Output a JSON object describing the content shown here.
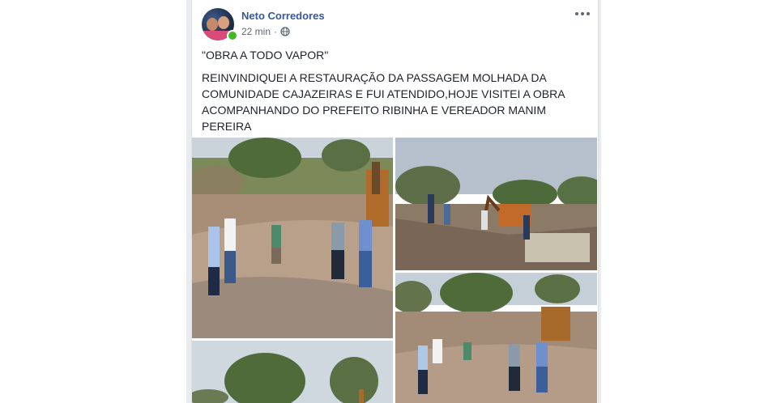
{
  "post": {
    "author": "Neto Corredores",
    "time": "22 min",
    "separator": "·",
    "privacy_icon": "globe-icon",
    "more_icon": "more-options-icon",
    "title_line": "\"OBRA A TODO VAPOR\"",
    "body_lines": [
      "REINVINDIQUEI A RESTAURAÇÃO DA PASSAGEM MOLHADA DA",
      "COMUNIDADE CAJAZEIRAS E FUI ATENDIDO,HOJE VISITEI A OBRA",
      "ACOMPANHANDO DO PREFEITO RIBINHA E VEREADOR MANIM",
      "PEREIRA"
    ]
  },
  "colors": {
    "author": "#365899",
    "text": "#1d2129",
    "meta": "#616770",
    "online": "#42b72a",
    "feed_background": "#e9ebee"
  },
  "photos": [
    {
      "name": "construction-site-group-photo"
    },
    {
      "name": "excavation-with-backhoe-photo"
    },
    {
      "name": "men-standing-near-backhoe-photo"
    },
    {
      "name": "trees-and-sky-photo"
    }
  ]
}
